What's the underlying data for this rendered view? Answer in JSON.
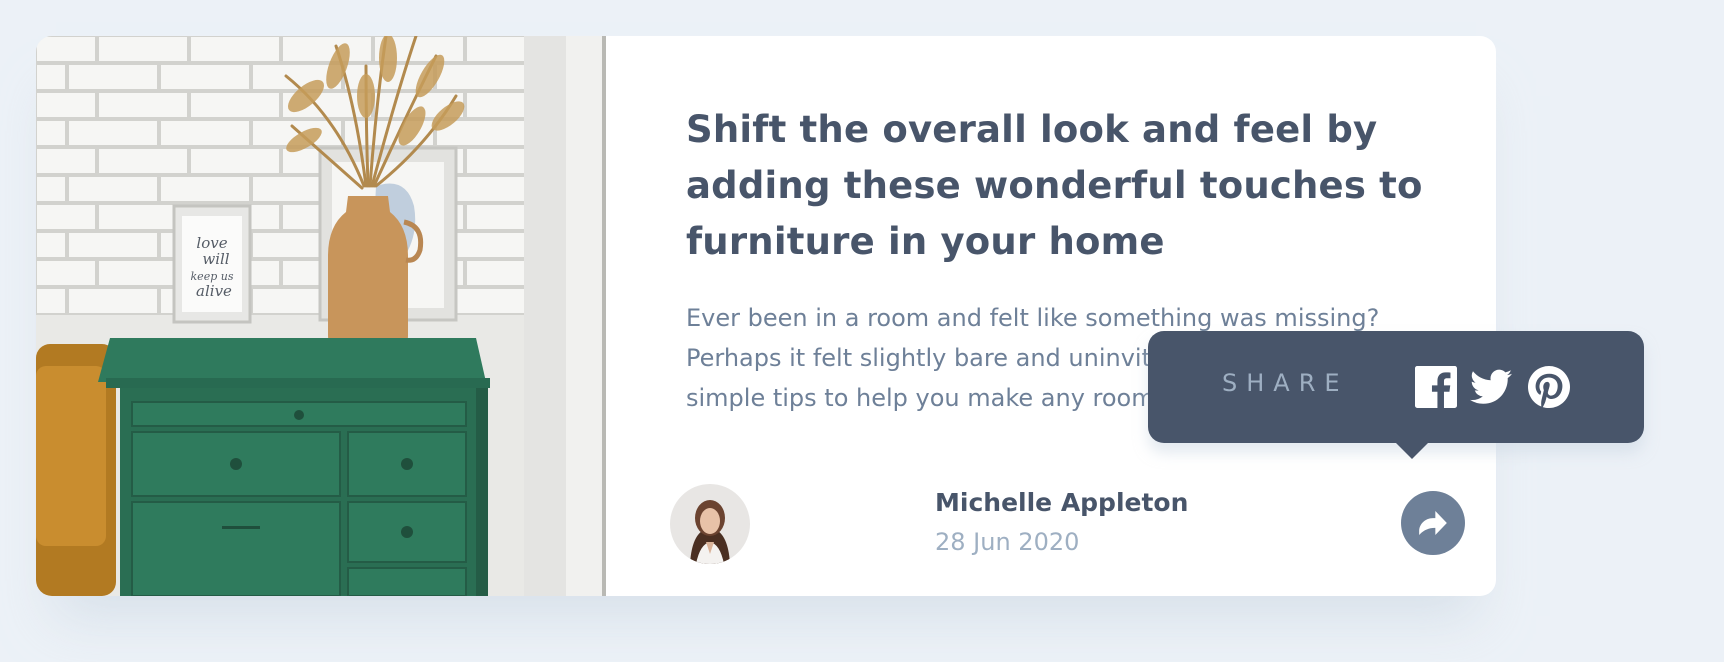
{
  "article": {
    "title": "Shift the overall look and feel by adding these wonderful touches to furniture in your home",
    "excerpt": "Ever been in a room and felt like something was missing? Perhaps it felt slightly bare and uninviting. I've got some simple tips to help you make any room feel complete.",
    "image_alt_frame_text": "love will keep us alive"
  },
  "author": {
    "name": "Michelle Appleton",
    "date": "28 Jun 2020"
  },
  "share": {
    "label": "SHARE",
    "icons": [
      "facebook-icon",
      "twitter-icon",
      "pinterest-icon"
    ],
    "button_icon": "share-icon"
  },
  "colors": {
    "background": "#ecf1f7",
    "card": "#ffffff",
    "title": "#48556a",
    "text": "#6e8098",
    "muted": "#9eafc2",
    "tooltip": "#48556a"
  }
}
